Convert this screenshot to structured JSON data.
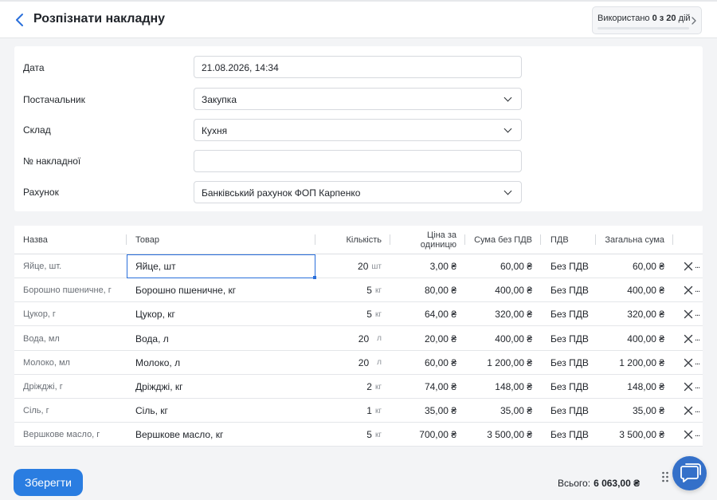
{
  "header": {
    "title": "Розпізнати накладну",
    "usage": {
      "prefix": "Використано ",
      "used": "0 з 20",
      "suffix": " дій",
      "progress_fraction": 0
    }
  },
  "form": {
    "date": {
      "label": "Дата",
      "value": "21.08.2026, 14:34"
    },
    "supplier": {
      "label": "Постачальник",
      "value": "Закупка"
    },
    "warehouse": {
      "label": "Склад",
      "value": "Кухня"
    },
    "invoice_number": {
      "label": "№ накладної",
      "value": ""
    },
    "account": {
      "label": "Рахунок",
      "value": "Банківський рахунок ФОП Карпенко"
    }
  },
  "table": {
    "columns": {
      "name": "Назва",
      "product": "Товар",
      "quantity": "Кількість",
      "unit_price": "Ціна за одиницю",
      "sum_no_vat": "Сума без ПДВ",
      "vat": "ПДВ",
      "total": "Загальна сума"
    },
    "rows": [
      {
        "name": "Яйце, шт.",
        "product": "Яйце, шт",
        "qty": "20",
        "unit": "шт",
        "price": "3,00 ₴",
        "sum": "60,00 ₴",
        "vat": "Без ПДВ",
        "total": "60,00 ₴"
      },
      {
        "name": "Борошно пшеничне, г",
        "product": "Борошно пшеничне, кг",
        "qty": "5",
        "unit": "кг",
        "price": "80,00 ₴",
        "sum": "400,00 ₴",
        "vat": "Без ПДВ",
        "total": "400,00 ₴"
      },
      {
        "name": "Цукор, г",
        "product": "Цукор, кг",
        "qty": "5",
        "unit": "кг",
        "price": "64,00 ₴",
        "sum": "320,00 ₴",
        "vat": "Без ПДВ",
        "total": "320,00 ₴"
      },
      {
        "name": "Вода, мл",
        "product": "Вода, л",
        "qty": "20",
        "unit": "л",
        "price": "20,00 ₴",
        "sum": "400,00 ₴",
        "vat": "Без ПДВ",
        "total": "400,00 ₴"
      },
      {
        "name": "Молоко, мл",
        "product": "Молоко, л",
        "qty": "20",
        "unit": "л",
        "price": "60,00 ₴",
        "sum": "1 200,00 ₴",
        "vat": "Без ПДВ",
        "total": "1 200,00 ₴"
      },
      {
        "name": "Дріжджі, г",
        "product": "Дріжджі, кг",
        "qty": "2",
        "unit": "кг",
        "price": "74,00 ₴",
        "sum": "148,00 ₴",
        "vat": "Без ПДВ",
        "total": "148,00 ₴"
      },
      {
        "name": "Сіль, г",
        "product": "Сіль, кг",
        "qty": "1",
        "unit": "кг",
        "price": "35,00 ₴",
        "sum": "35,00 ₴",
        "vat": "Без ПДВ",
        "total": "35,00 ₴"
      },
      {
        "name": "Вершкове масло, г",
        "product": "Вершкове масло, кг",
        "qty": "5",
        "unit": "кг",
        "price": "700,00 ₴",
        "sum": "3 500,00 ₴",
        "vat": "Без ПДВ",
        "total": "3 500,00 ₴"
      }
    ],
    "more_label": "..."
  },
  "footer": {
    "save_label": "Зберегти",
    "total_label": "Всього:",
    "total_value": "6 063,00 ₴"
  },
  "colors": {
    "accent": "#2a7de1",
    "chat": "#3470c9",
    "focus": "#2a6fdb"
  },
  "icons": {
    "back": "chevron-left-icon",
    "usage": "chevron-right-icon",
    "select": "chevron-down-icon",
    "delete": "close-icon",
    "drag": "drag-handle-icon",
    "chat": "chat-icon"
  }
}
